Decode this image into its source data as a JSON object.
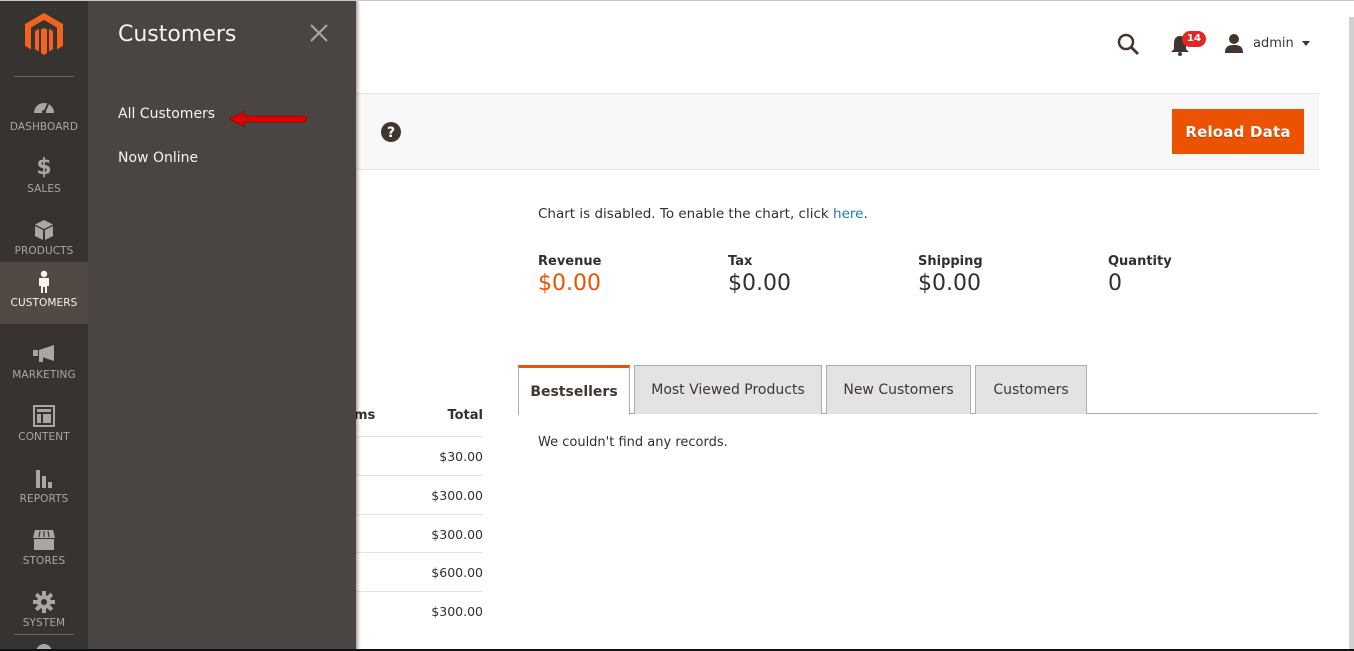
{
  "nav": {
    "items": [
      {
        "id": "dashboard",
        "label": "DASHBOARD",
        "icon": "dashboard-gauge-icon"
      },
      {
        "id": "sales",
        "label": "SALES",
        "icon": "dollar-icon"
      },
      {
        "id": "products",
        "label": "PRODUCTS",
        "icon": "box-icon"
      },
      {
        "id": "customers",
        "label": "CUSTOMERS",
        "icon": "person-icon",
        "active": true
      },
      {
        "id": "marketing",
        "label": "MARKETING",
        "icon": "megaphone-icon"
      },
      {
        "id": "content",
        "label": "CONTENT",
        "icon": "layout-icon"
      },
      {
        "id": "reports",
        "label": "REPORTS",
        "icon": "bar-chart-icon"
      },
      {
        "id": "stores",
        "label": "STORES",
        "icon": "storefront-icon"
      },
      {
        "id": "system",
        "label": "SYSTEM",
        "icon": "gear-icon"
      }
    ]
  },
  "submenu": {
    "title": "Customers",
    "links": [
      "All Customers",
      "Now Online"
    ]
  },
  "header": {
    "notifications_count": "14",
    "user_name": "admin"
  },
  "actions": {
    "reload_label": "Reload Data"
  },
  "dashboard": {
    "chart_message": "Chart is disabled. To enable the chart, click ",
    "chart_link": "here",
    "chart_message_end": ".",
    "totals": [
      {
        "label": "Revenue",
        "value": "$0.00"
      },
      {
        "label": "Tax",
        "value": "$0.00"
      },
      {
        "label": "Shipping",
        "value": "$0.00"
      },
      {
        "label": "Quantity",
        "value": "0"
      }
    ],
    "orders_table": {
      "headers": [
        "ms",
        "Total"
      ],
      "totals": [
        "$30.00",
        "$300.00",
        "$300.00",
        "$600.00",
        "$300.00"
      ]
    },
    "tabs": [
      "Bestsellers",
      "Most Viewed Products",
      "New Customers",
      "Customers"
    ],
    "active_tab": "Bestsellers",
    "empty_message": "We couldn't find any records."
  },
  "colors": {
    "accent": "#eb5202",
    "nav_bg": "#373330",
    "submenu_bg": "#4a4542",
    "link": "#1979c3",
    "badge": "#e22626"
  }
}
